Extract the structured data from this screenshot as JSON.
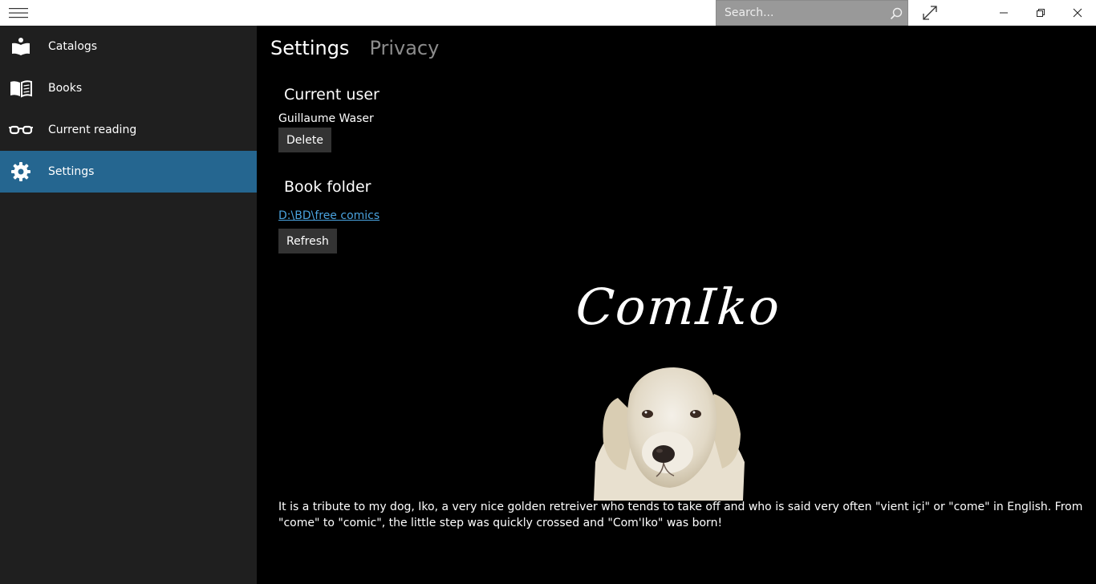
{
  "search": {
    "placeholder": "Search..."
  },
  "sidebar": {
    "items": [
      {
        "label": "Catalogs",
        "icon": "catalog-icon"
      },
      {
        "label": "Books",
        "icon": "open-book-icon"
      },
      {
        "label": "Current reading",
        "icon": "glasses-icon"
      },
      {
        "label": "Settings",
        "icon": "gear-icon",
        "selected": true
      }
    ]
  },
  "main": {
    "tabs": [
      {
        "label": "Settings",
        "active": true
      },
      {
        "label": "Privacy",
        "active": false
      }
    ],
    "current_user": {
      "title": "Current user",
      "name": "Guillaume Waser",
      "delete_label": "Delete"
    },
    "book_folder": {
      "title": "Book folder",
      "path": "D:\\BD\\free comics",
      "refresh_label": "Refresh"
    },
    "logo_text": "ComIko",
    "tribute": "It is a tribute to my dog, Iko, a very nice golden retreiver who tends to take off and who is said very often \"vient içi\" or \"come\" in English. From \"come\" to \"comic\", the little step was quickly crossed and \"Com'Iko\" was born!"
  },
  "colors": {
    "accent": "#256690",
    "link": "#4aa3df",
    "sidebar_bg": "#1f1f1f",
    "main_bg": "#000000",
    "button_bg": "#333333"
  }
}
